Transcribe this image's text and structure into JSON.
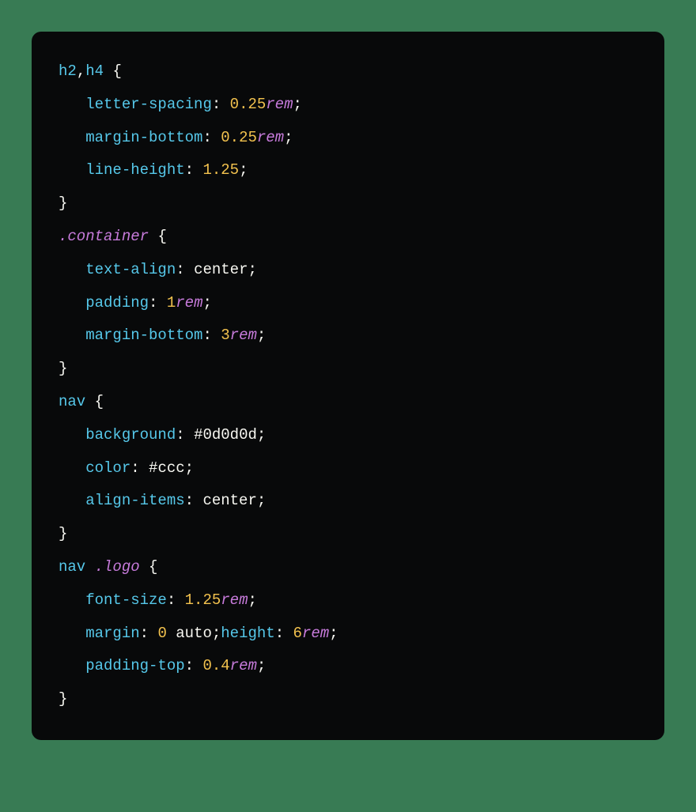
{
  "rules": [
    {
      "selector_parts": [
        {
          "t": "selector",
          "v": "h2"
        },
        {
          "t": "punc",
          "v": ","
        },
        {
          "t": "selector",
          "v": "h4"
        }
      ],
      "declarations": [
        [
          {
            "t": "prop",
            "v": "letter-spacing"
          },
          {
            "t": "colon",
            "v": ":"
          },
          {
            "t": "sp",
            "v": " "
          },
          {
            "t": "number",
            "v": "0.25"
          },
          {
            "t": "unit",
            "v": "rem"
          },
          {
            "t": "punc",
            "v": ";"
          }
        ],
        [
          {
            "t": "prop",
            "v": "margin-bottom"
          },
          {
            "t": "colon",
            "v": ":"
          },
          {
            "t": "sp",
            "v": " "
          },
          {
            "t": "number",
            "v": "0.25"
          },
          {
            "t": "unit",
            "v": "rem"
          },
          {
            "t": "punc",
            "v": ";"
          }
        ],
        [
          {
            "t": "prop",
            "v": "line-height"
          },
          {
            "t": "colon",
            "v": ":"
          },
          {
            "t": "sp",
            "v": " "
          },
          {
            "t": "number",
            "v": "1.25"
          },
          {
            "t": "punc",
            "v": ";"
          }
        ]
      ]
    },
    {
      "selector_parts": [
        {
          "t": "class",
          "v": ".container"
        }
      ],
      "declarations": [
        [
          {
            "t": "prop",
            "v": "text-align"
          },
          {
            "t": "colon",
            "v": ":"
          },
          {
            "t": "sp",
            "v": " "
          },
          {
            "t": "value",
            "v": "center"
          },
          {
            "t": "punc",
            "v": ";"
          }
        ],
        [
          {
            "t": "prop",
            "v": "padding"
          },
          {
            "t": "colon",
            "v": ":"
          },
          {
            "t": "sp",
            "v": " "
          },
          {
            "t": "number",
            "v": "1"
          },
          {
            "t": "unit",
            "v": "rem"
          },
          {
            "t": "punc",
            "v": ";"
          }
        ],
        [
          {
            "t": "prop",
            "v": "margin-bottom"
          },
          {
            "t": "colon",
            "v": ":"
          },
          {
            "t": "sp",
            "v": " "
          },
          {
            "t": "number",
            "v": "3"
          },
          {
            "t": "unit",
            "v": "rem"
          },
          {
            "t": "punc",
            "v": ";"
          }
        ]
      ]
    },
    {
      "selector_parts": [
        {
          "t": "selector",
          "v": "nav"
        }
      ],
      "declarations": [
        [
          {
            "t": "prop",
            "v": "background"
          },
          {
            "t": "colon",
            "v": ":"
          },
          {
            "t": "sp",
            "v": " "
          },
          {
            "t": "hex",
            "v": "#0d0d0d"
          },
          {
            "t": "punc",
            "v": ";"
          }
        ],
        [
          {
            "t": "prop",
            "v": "color"
          },
          {
            "t": "colon",
            "v": ":"
          },
          {
            "t": "sp",
            "v": " "
          },
          {
            "t": "hex",
            "v": "#ccc"
          },
          {
            "t": "punc",
            "v": ";"
          }
        ],
        [
          {
            "t": "prop",
            "v": "align-items"
          },
          {
            "t": "colon",
            "v": ":"
          },
          {
            "t": "sp",
            "v": " "
          },
          {
            "t": "value",
            "v": "center"
          },
          {
            "t": "punc",
            "v": ";"
          }
        ]
      ]
    },
    {
      "selector_parts": [
        {
          "t": "selector",
          "v": "nav"
        },
        {
          "t": "sp",
          "v": " "
        },
        {
          "t": "class",
          "v": ".logo"
        }
      ],
      "declarations": [
        [
          {
            "t": "prop",
            "v": "font-size"
          },
          {
            "t": "colon",
            "v": ":"
          },
          {
            "t": "sp",
            "v": " "
          },
          {
            "t": "number",
            "v": "1.25"
          },
          {
            "t": "unit",
            "v": "rem"
          },
          {
            "t": "punc",
            "v": ";"
          }
        ],
        [
          {
            "t": "prop",
            "v": "margin"
          },
          {
            "t": "colon",
            "v": ":"
          },
          {
            "t": "sp",
            "v": " "
          },
          {
            "t": "number",
            "v": "0"
          },
          {
            "t": "sp",
            "v": " "
          },
          {
            "t": "value",
            "v": "auto"
          },
          {
            "t": "punc",
            "v": ";"
          },
          {
            "t": "prop",
            "v": "height"
          },
          {
            "t": "colon",
            "v": ":"
          },
          {
            "t": "sp",
            "v": " "
          },
          {
            "t": "number",
            "v": "6"
          },
          {
            "t": "unit",
            "v": "rem"
          },
          {
            "t": "punc",
            "v": ";"
          }
        ],
        [
          {
            "t": "prop",
            "v": "padding-top"
          },
          {
            "t": "colon",
            "v": ":"
          },
          {
            "t": "sp",
            "v": " "
          },
          {
            "t": "number",
            "v": "0.4"
          },
          {
            "t": "unit",
            "v": "rem"
          },
          {
            "t": "punc",
            "v": ";"
          }
        ]
      ]
    }
  ],
  "braces": {
    "open": "{",
    "close": "}"
  },
  "indent": "   "
}
